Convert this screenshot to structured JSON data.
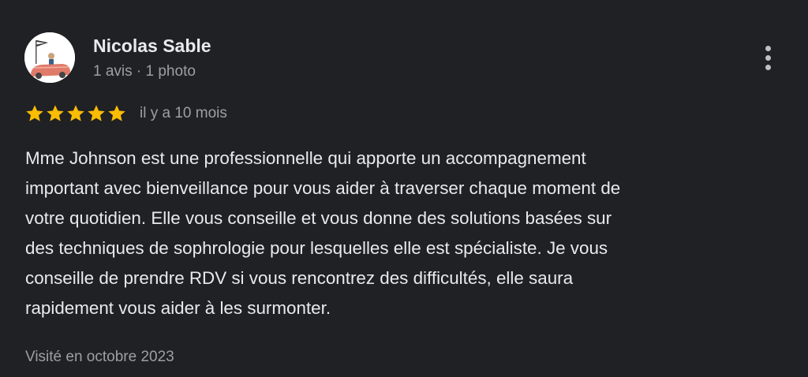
{
  "review": {
    "author": {
      "name": "Nicolas Sable",
      "meta": "1 avis · 1 photo",
      "avatar_icon": "user-avatar-photo"
    },
    "rating": {
      "stars": 5,
      "max": 5,
      "star_color": "#fbbc04"
    },
    "relative_date": "il y a 10 mois",
    "text_lines": [
      "Mme Johnson est une professionnelle qui apporte un accompagnement",
      "important avec bienveillance pour vous aider à traverser chaque moment de",
      "votre quotidien. Elle vous conseille et vous donne des solutions basées sur",
      "des techniques de sophrologie pour lesquelles elle est spécialiste. Je vous",
      "conseille de prendre RDV si vous rencontrez des difficultés, elle saura",
      "rapidement vous aider à les surmonter."
    ],
    "visit": "Visité en octobre 2023",
    "more_icon": "more-vert-icon"
  },
  "colors": {
    "background": "#202124",
    "primary_text": "#e8eaed",
    "secondary_text": "#9aa0a6"
  }
}
